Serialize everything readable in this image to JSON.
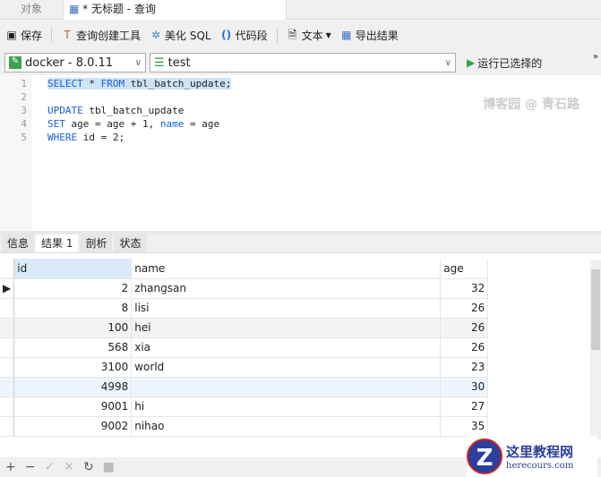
{
  "tabs": {
    "objects": "对象",
    "query": "* 无标题 - 查询"
  },
  "toolbar": {
    "save": "保存",
    "builder": "查询创建工具",
    "beautify": "美化 SQL",
    "snippet": "代码段",
    "text": "文本",
    "export": "导出结果"
  },
  "connection": {
    "server": "docker - 8.0.11",
    "database": "test",
    "run": "运行已选择的"
  },
  "editor": {
    "line_numbers": [
      "1",
      "2",
      "3",
      "4",
      "5"
    ],
    "lines": [
      [
        "SELECT",
        " * ",
        "FROM",
        " tbl_batch_update;"
      ],
      [],
      [
        "UPDATE",
        " tbl_batch_update"
      ],
      [
        "SET",
        " age = age + 1, ",
        "name",
        " = age"
      ],
      [
        "WHERE",
        " id = 2;"
      ]
    ],
    "watermark": "博客园 @ 青石路"
  },
  "result_tabs": [
    "信息",
    "结果 1",
    "剖析",
    "状态"
  ],
  "columns": [
    "id",
    "name",
    "age"
  ],
  "rows": [
    [
      "2",
      "zhangsan",
      "32"
    ],
    [
      "8",
      "lisi",
      "26"
    ],
    [
      "100",
      "hei",
      "26"
    ],
    [
      "568",
      "xia",
      "26"
    ],
    [
      "3100",
      "world",
      "23"
    ],
    [
      "4998",
      "",
      "30"
    ],
    [
      "9001",
      "hi",
      "27"
    ],
    [
      "9002",
      "nihao",
      "35"
    ]
  ],
  "logo": {
    "title": "这里教程网",
    "url": "herecours.com"
  }
}
